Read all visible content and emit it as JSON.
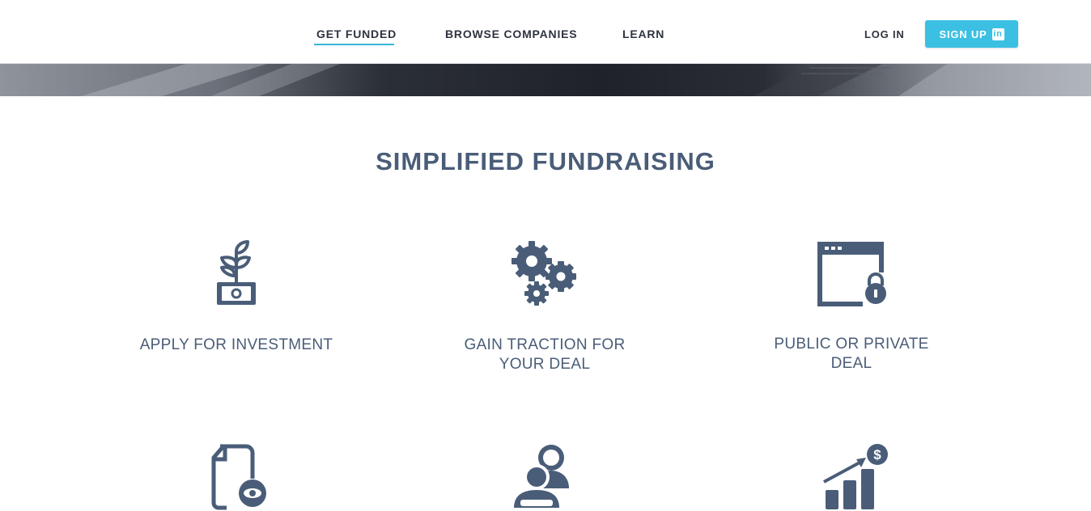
{
  "nav": {
    "items": [
      "GET FUNDED",
      "BROWSE COMPANIES",
      "LEARN"
    ],
    "active": "GET FUNDED",
    "login_label": "LOG IN",
    "signup_label": "SIGN UP",
    "signup_icon": "linkedin-icon"
  },
  "section": {
    "title": "SIMPLIFIED FUNDRAISING"
  },
  "features": [
    {
      "icon": "plant-money-icon",
      "label": "APPLY FOR INVESTMENT"
    },
    {
      "icon": "gears-icon",
      "label_lines": [
        "GAIN TRACTION FOR",
        "YOUR DEAL"
      ]
    },
    {
      "icon": "browser-lock-icon",
      "label_lines": [
        "PUBLIC OR PRIVATE",
        "DEAL"
      ]
    },
    {
      "icon": "document-eye-icon"
    },
    {
      "icon": "users-icon"
    },
    {
      "icon": "chart-growth-icon"
    }
  ],
  "colors": {
    "accent": "#3bc0e3",
    "icon": "#4a5d78",
    "heading": "#4a5d78"
  }
}
